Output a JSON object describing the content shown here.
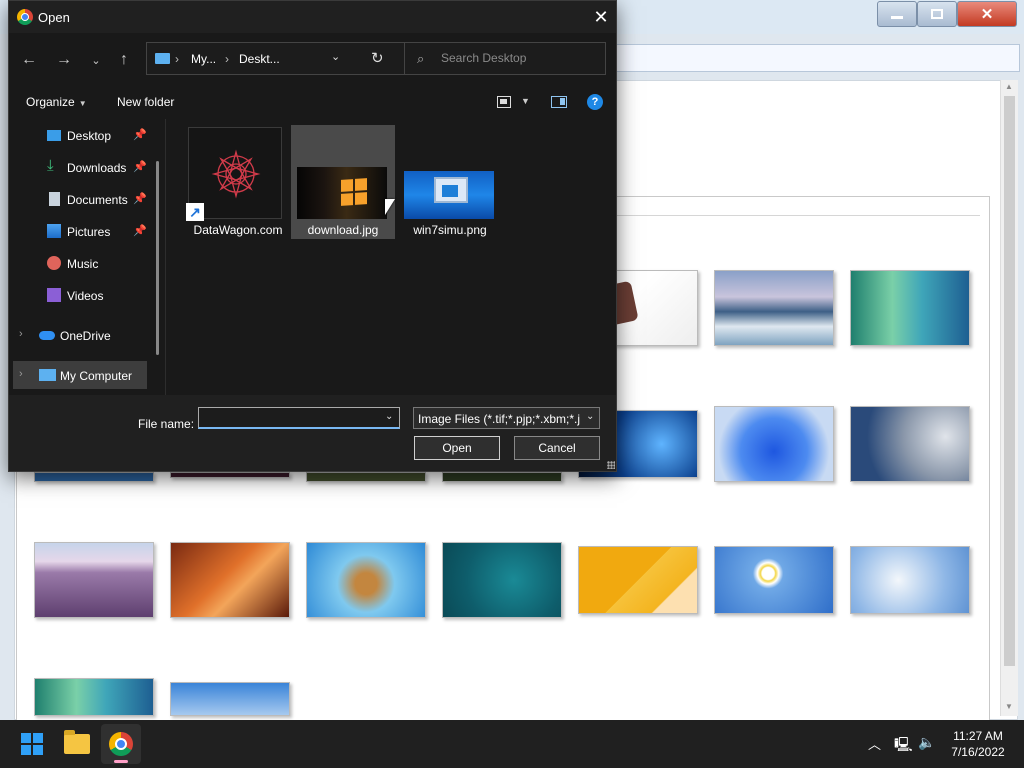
{
  "dialog": {
    "title": "Open",
    "close_glyph": "✕",
    "breadcrumb": [
      "My...",
      "Deskt..."
    ],
    "breadcrumb_sep": "›",
    "search_placeholder": "Search Desktop",
    "toolbar": {
      "organize_label": "Organize",
      "new_folder_label": "New folder",
      "help_glyph": "?"
    },
    "nav_items": [
      {
        "label": "Desktop",
        "icon": "desktop-icon",
        "pinned": true
      },
      {
        "label": "Downloads",
        "icon": "download-icon",
        "pinned": true
      },
      {
        "label": "Documents",
        "icon": "document-icon",
        "pinned": true
      },
      {
        "label": "Pictures",
        "icon": "pictures-icon",
        "pinned": true
      },
      {
        "label": "Music",
        "icon": "music-icon",
        "pinned": false
      },
      {
        "label": "Videos",
        "icon": "videos-icon",
        "pinned": false
      },
      {
        "label": "OneDrive",
        "icon": "cloud-icon",
        "expandable": true
      },
      {
        "label": "My Computer",
        "icon": "computer-icon",
        "expandable": true,
        "selected": true
      }
    ],
    "files": [
      {
        "name": "DataWagon.com",
        "type": "shortcut"
      },
      {
        "name": "download.jpg",
        "type": "image",
        "selected": true
      },
      {
        "name": "win7simu.png",
        "type": "image"
      }
    ],
    "file_name_label": "File name:",
    "file_name_value": "",
    "file_type_value": "Image Files (*.tif;*.pjp;*.xbm;*.jxl;*.svgz;*.jpg;*.jpeg)",
    "open_label": "Open",
    "cancel_label": "Cancel"
  },
  "taskbar": {
    "time": "11:27 AM",
    "date": "7/16/2022",
    "accent": "#2fa0f7"
  }
}
